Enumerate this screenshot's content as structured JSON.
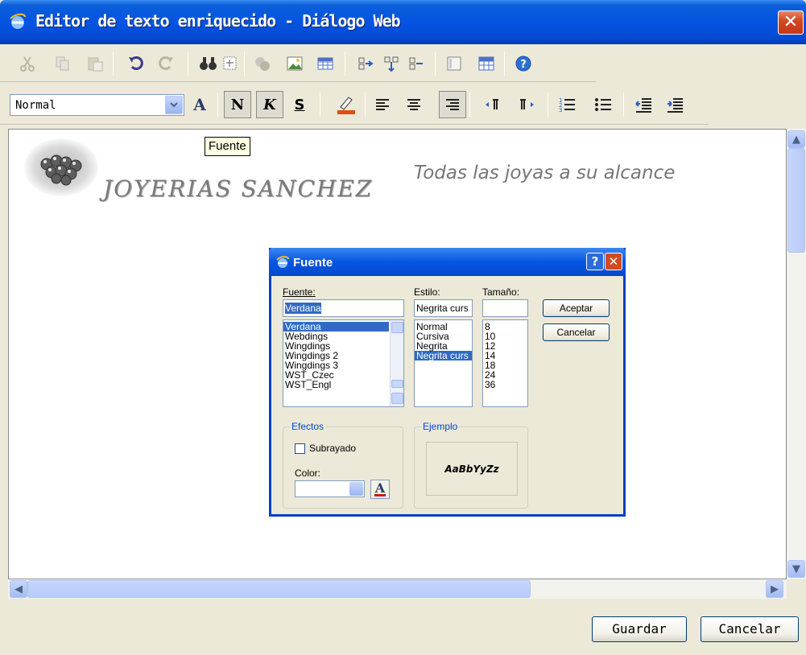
{
  "window": {
    "title": "Editor de texto enriquecido - Diálogo Web",
    "close": "✕"
  },
  "toolbar": {
    "style_value": "Normal",
    "bold_label": "N",
    "italic_label": "K",
    "strike_label": "S",
    "font_label": "A"
  },
  "tooltip": "Fuente",
  "content": {
    "brand": "JOYERIAS SANCHEZ",
    "tagline": "Todas las joyas a su alcance"
  },
  "font_dialog": {
    "title": "Fuente",
    "help": "?",
    "close": "✕",
    "font_label": "Fuente:",
    "font_value": "Verdana",
    "fonts": [
      "Verdana",
      "Webdings",
      "Wingdings",
      "Wingdings 2",
      "Wingdings 3",
      "WST_Czec",
      "WST_Engl"
    ],
    "style_label": "Estilo:",
    "style_value": "Negrita curs",
    "styles": [
      "Normal",
      "Cursiva",
      "Negrita",
      "Negrita curs"
    ],
    "size_label": "Tamaño:",
    "size_value": "",
    "sizes": [
      "8",
      "10",
      "12",
      "14",
      "18",
      "24",
      "36"
    ],
    "accept": "Aceptar",
    "cancel": "Cancelar",
    "effects_label": "Efectos",
    "underline_label": "Subrayado",
    "color_label": "Color:",
    "sample_label": "Ejemplo",
    "sample_text": "AaBbYyZz"
  },
  "footer": {
    "save": "Guardar",
    "cancel": "Cancelar"
  },
  "colors": {
    "titlebar": "#0554e3",
    "selection": "#316ac5",
    "close": "#d24a21"
  }
}
